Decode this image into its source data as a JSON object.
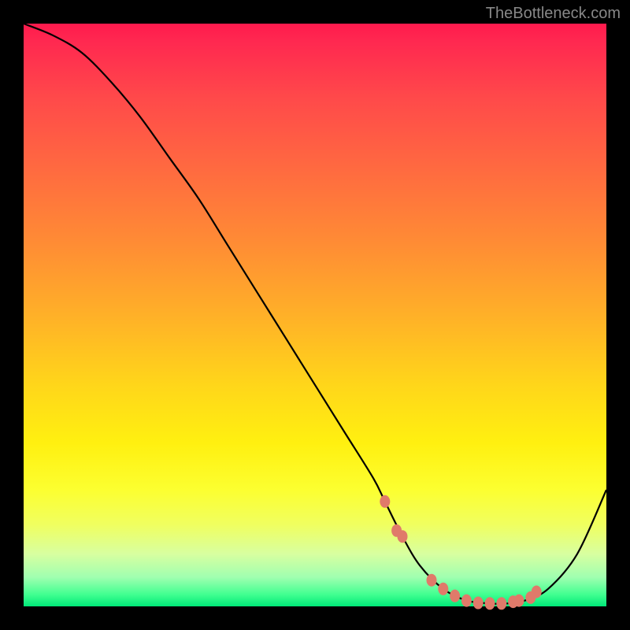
{
  "watermark": "TheBottleneck.com",
  "chart_data": {
    "type": "line",
    "title": "",
    "xlabel": "",
    "ylabel": "",
    "xlim": [
      0,
      100
    ],
    "ylim": [
      0,
      100
    ],
    "grid": false,
    "series": [
      {
        "name": "curve",
        "x": [
          0,
          5,
          10,
          15,
          20,
          25,
          30,
          35,
          40,
          45,
          50,
          55,
          60,
          62,
          65,
          68,
          72,
          76,
          80,
          83,
          86,
          90,
          95,
          100
        ],
        "values": [
          100,
          98,
          95,
          90,
          84,
          77,
          70,
          62,
          54,
          46,
          38,
          30,
          22,
          18,
          12,
          7,
          3,
          1,
          0.5,
          0.5,
          1,
          3,
          9,
          20
        ]
      }
    ],
    "markers": {
      "name": "highlight-dots",
      "color": "#e07a6a",
      "points": [
        {
          "x": 62,
          "y": 18
        },
        {
          "x": 64,
          "y": 13
        },
        {
          "x": 65,
          "y": 12
        },
        {
          "x": 70,
          "y": 4.5
        },
        {
          "x": 72,
          "y": 3
        },
        {
          "x": 74,
          "y": 1.8
        },
        {
          "x": 76,
          "y": 1
        },
        {
          "x": 78,
          "y": 0.6
        },
        {
          "x": 80,
          "y": 0.5
        },
        {
          "x": 82,
          "y": 0.5
        },
        {
          "x": 84,
          "y": 0.8
        },
        {
          "x": 85,
          "y": 1
        },
        {
          "x": 87,
          "y": 1.5
        },
        {
          "x": 88,
          "y": 2.5
        }
      ]
    },
    "gradient_stops": [
      {
        "pos": 0,
        "color": "#ff1a4d"
      },
      {
        "pos": 13,
        "color": "#ff4a4a"
      },
      {
        "pos": 25,
        "color": "#ff6a40"
      },
      {
        "pos": 37,
        "color": "#ff8a35"
      },
      {
        "pos": 50,
        "color": "#ffb028"
      },
      {
        "pos": 62,
        "color": "#ffd61a"
      },
      {
        "pos": 80,
        "color": "#fcff30"
      },
      {
        "pos": 95,
        "color": "#a0ffb0"
      },
      {
        "pos": 100,
        "color": "#00e878"
      }
    ]
  }
}
